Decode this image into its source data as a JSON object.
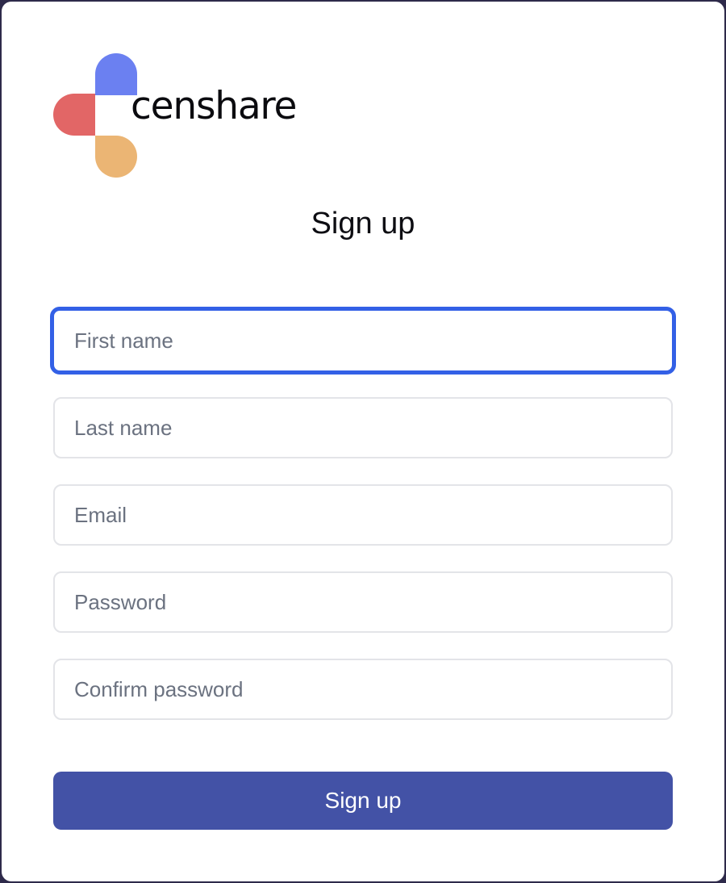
{
  "brand": {
    "name": "censhare",
    "colors": {
      "blue": "#6b80f1",
      "red": "#e26666",
      "orange": "#ebb574"
    }
  },
  "form": {
    "title": "Sign up",
    "fields": {
      "first_name": {
        "placeholder": "First name",
        "value": "",
        "focused": true
      },
      "last_name": {
        "placeholder": "Last name",
        "value": ""
      },
      "email": {
        "placeholder": "Email",
        "value": ""
      },
      "password": {
        "placeholder": "Password",
        "value": ""
      },
      "confirm_password": {
        "placeholder": "Confirm password",
        "value": ""
      }
    },
    "submit_label": "Sign up"
  },
  "colors": {
    "focus_ring": "#3360e6",
    "button": "#4352a6",
    "backdrop": "#2e2a4a"
  }
}
